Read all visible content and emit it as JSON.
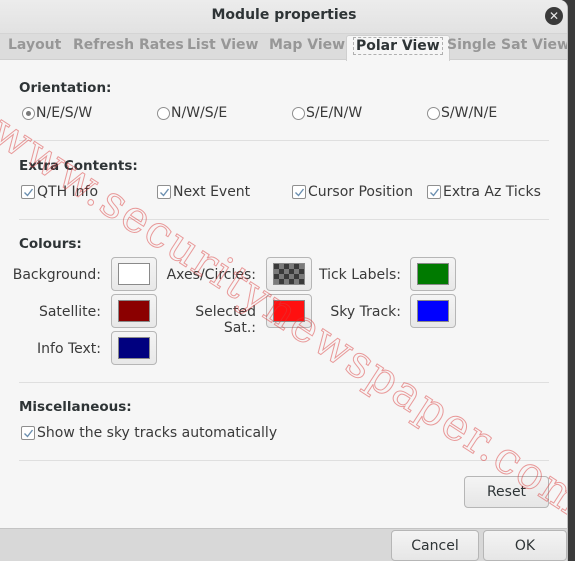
{
  "window": {
    "title": "Module properties",
    "close_icon": "close-icon"
  },
  "tabs": [
    {
      "label": "Layout",
      "active": false
    },
    {
      "label": "Refresh Rates",
      "active": false
    },
    {
      "label": "List View",
      "active": false
    },
    {
      "label": "Map View",
      "active": false
    },
    {
      "label": "Polar View",
      "active": true
    },
    {
      "label": "Single Sat View",
      "active": false
    }
  ],
  "orientation": {
    "label": "Orientation:",
    "options": [
      {
        "label": "N/E/S/W",
        "selected": true
      },
      {
        "label": "N/W/S/E",
        "selected": false
      },
      {
        "label": "S/E/N/W",
        "selected": false
      },
      {
        "label": "S/W/N/E",
        "selected": false
      }
    ]
  },
  "extra_contents": {
    "label": "Extra Contents:",
    "options": [
      {
        "label": "QTH Info",
        "checked": true
      },
      {
        "label": "Next Event",
        "checked": true
      },
      {
        "label": "Cursor Position",
        "checked": true
      },
      {
        "label": "Extra Az Ticks",
        "checked": true
      }
    ]
  },
  "colours": {
    "label": "Colours:",
    "items": [
      {
        "label": "Background:",
        "color": "#ffffff"
      },
      {
        "label": "Axes/Circles:",
        "color": "checkerboard"
      },
      {
        "label": "Tick Labels:",
        "color": "#007a00"
      },
      {
        "label": "Satellite:",
        "color": "#8b0000"
      },
      {
        "label": "Selected Sat.:",
        "color": "#ff1010"
      },
      {
        "label": "Sky Track:",
        "color": "#0000ff"
      },
      {
        "label": "Info Text:",
        "color": "#00007f"
      }
    ]
  },
  "miscellaneous": {
    "label": "Miscellaneous:",
    "options": [
      {
        "label": "Show the sky tracks automatically",
        "checked": true
      }
    ]
  },
  "buttons": {
    "reset": "Reset",
    "cancel": "Cancel",
    "ok": "OK"
  },
  "watermark": "www.securitynewspaper.com"
}
